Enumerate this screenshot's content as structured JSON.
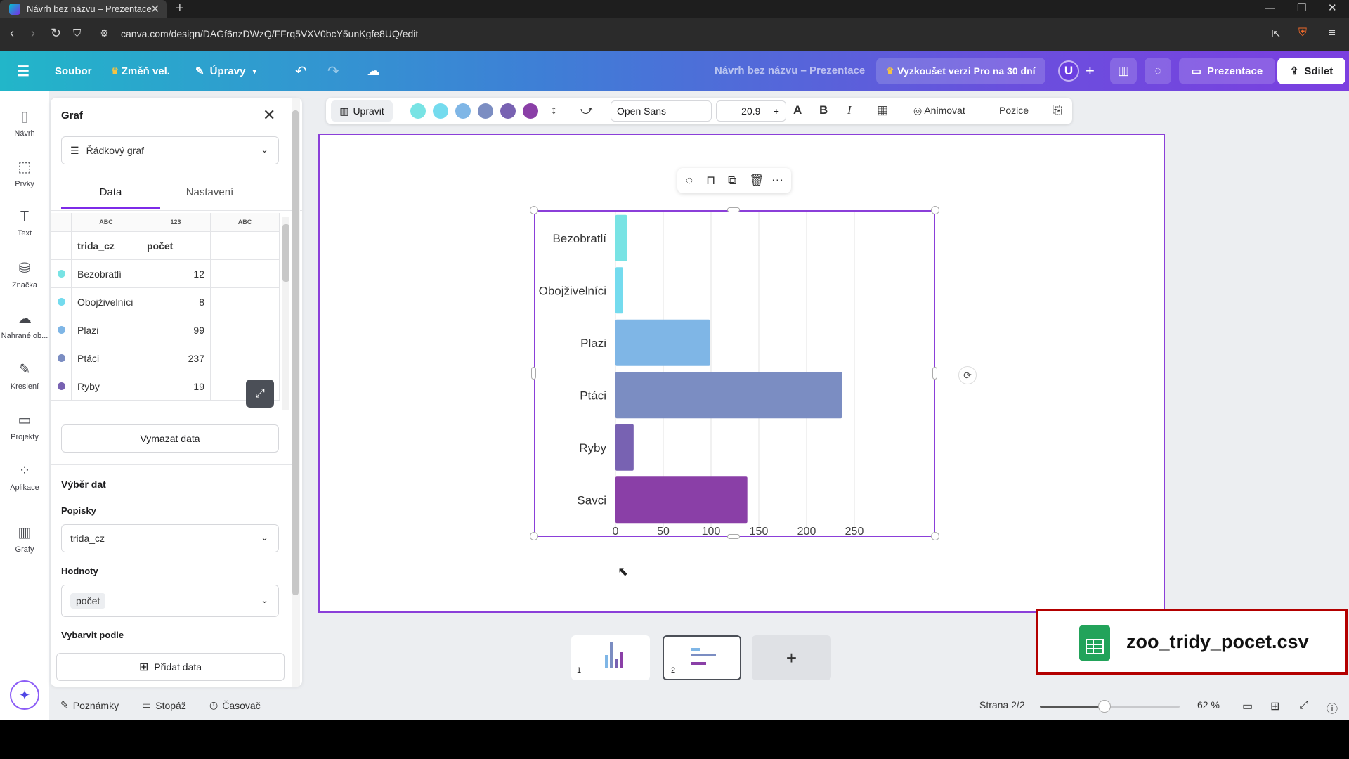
{
  "browser": {
    "tab_title": "Návrh bez názvu – Prezentace",
    "tab_close": "✕",
    "new_tab": "+",
    "url": "canva.com/design/DAGf6nzDWzQ/FFrq5VXV0bcY5unKgfe8UQ/edit"
  },
  "header": {
    "menu_icon": "☰",
    "file": "Soubor",
    "resize": "Změň vel.",
    "edit": "Úpravy",
    "doc_title": "Návrh bez názvu – Prezentace",
    "pro_trial": "Vyzkoušet verzi Pro na 30 dní",
    "avatar": "U",
    "plus": "+",
    "present": "Prezentace",
    "share": "Sdílet"
  },
  "rail": [
    {
      "label": "Návrh",
      "icon": "design-icon",
      "glyph": "▯"
    },
    {
      "label": "Prvky",
      "icon": "elements-icon",
      "glyph": "⬚"
    },
    {
      "label": "Text",
      "icon": "text-icon",
      "glyph": "T"
    },
    {
      "label": "Značka",
      "icon": "brand-icon",
      "glyph": "⛁"
    },
    {
      "label": "Nahrané ob...",
      "icon": "uploads-icon",
      "glyph": "☁"
    },
    {
      "label": "Kreslení",
      "icon": "draw-icon",
      "glyph": "✎"
    },
    {
      "label": "Projekty",
      "icon": "projects-icon",
      "glyph": "▭"
    },
    {
      "label": "Aplikace",
      "icon": "apps-icon",
      "glyph": "⁘"
    },
    {
      "label": "Grafy",
      "icon": "charts-icon",
      "glyph": "▥"
    }
  ],
  "panel": {
    "title": "Graf",
    "close": "✕",
    "chart_type": "Řádkový graf",
    "tabs": {
      "data": "Data",
      "settings": "Nastavení"
    },
    "col_types": [
      "ABC",
      "123",
      "ABC"
    ],
    "col_headers": [
      "trida_cz",
      "počet",
      ""
    ],
    "rows": [
      {
        "label": "Bezobratlí",
        "value": "12",
        "color": "#78e3e4"
      },
      {
        "label": "Obojživelníci",
        "value": "8",
        "color": "#74dbee"
      },
      {
        "label": "Plazi",
        "value": "99",
        "color": "#7fb6e6"
      },
      {
        "label": "Ptáci",
        "value": "237",
        "color": "#7b8dc2"
      },
      {
        "label": "Ryby",
        "value": "19",
        "color": "#7862b2"
      }
    ],
    "clear_data": "Vymazat data",
    "data_selection": "Výběr dat",
    "labels_title": "Popisky",
    "labels_value": "trida_cz",
    "values_title": "Hodnoty",
    "values_value": "počet",
    "color_by": "Vybarvit podle",
    "add_data": "Přidat data"
  },
  "toolbar": {
    "edit": "Upravit",
    "swatches": [
      "#78e3e4",
      "#74dbee",
      "#7fb6e6",
      "#7b8dc2",
      "#7862b2",
      "#8a3fa7"
    ],
    "font": "Open Sans",
    "minus": "–",
    "font_size": "20.9",
    "plus": "+",
    "bold": "B",
    "italic": "I",
    "animate": "Animovat",
    "position": "Pozice"
  },
  "chart_data": {
    "type": "bar",
    "orientation": "horizontal",
    "categories": [
      "Bezobratlí",
      "Obojživelníci",
      "Plazi",
      "Ptáci",
      "Ryby",
      "Savci"
    ],
    "values": [
      12,
      8,
      99,
      237,
      19,
      138
    ],
    "colors": [
      "#78e3e4",
      "#74dbee",
      "#7fb6e6",
      "#7b8dc2",
      "#7862b2",
      "#8a3fa7"
    ],
    "xticks": [
      0,
      50,
      100,
      150,
      200,
      250
    ],
    "xlim": [
      0,
      250
    ],
    "grid": true
  },
  "bottom": {
    "thumb1_num": "1",
    "thumb2_num": "2",
    "add_page": "+",
    "csv_file": "zoo_tridy_pocet.csv",
    "notes": "Poznámky",
    "footage": "Stopáž",
    "timer": "Časovač",
    "page_indicator": "Strana 2/2",
    "zoom": "62 %",
    "zoom_fraction": 0.46
  }
}
